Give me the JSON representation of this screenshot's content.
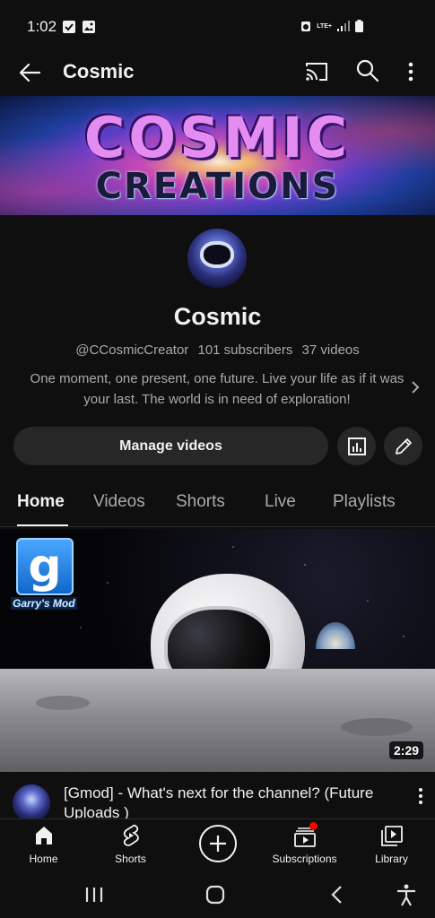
{
  "status_bar": {
    "time": "1:02",
    "network_label": "LTE+"
  },
  "top_bar": {
    "title": "Cosmic"
  },
  "banner": {
    "line1": "COSMIC",
    "line2": "CREATIONS"
  },
  "channel": {
    "name": "Cosmic",
    "handle": "@CCosmicCreator",
    "subscribers": "101 subscribers",
    "videos": "37 videos",
    "description": "One moment, one present, one future. Live your life as if it was your last. The world is in need of exploration!"
  },
  "actions": {
    "manage_label": "Manage videos"
  },
  "tabs": [
    {
      "label": "Home",
      "active": true
    },
    {
      "label": "Videos",
      "active": false
    },
    {
      "label": "Shorts",
      "active": false
    },
    {
      "label": "Live",
      "active": false
    },
    {
      "label": "Playlists",
      "active": false
    }
  ],
  "video": {
    "thumbnail_logo": "g",
    "thumbnail_logo_label": "Garry's Mod",
    "duration": "2:29",
    "title": "[Gmod] - What's next for the channel? (Future Uploads )"
  },
  "bottom_nav": [
    {
      "label": "Home",
      "icon": "home-icon"
    },
    {
      "label": "Shorts",
      "icon": "shorts-icon"
    },
    {
      "label": "",
      "icon": "create-icon"
    },
    {
      "label": "Subscriptions",
      "icon": "subscriptions-icon"
    },
    {
      "label": "Library",
      "icon": "library-icon"
    }
  ],
  "colors": {
    "background": "#0f0f0f",
    "button_bg": "#272727",
    "secondary_text": "#aaaaaa",
    "badge": "#ff0000"
  }
}
